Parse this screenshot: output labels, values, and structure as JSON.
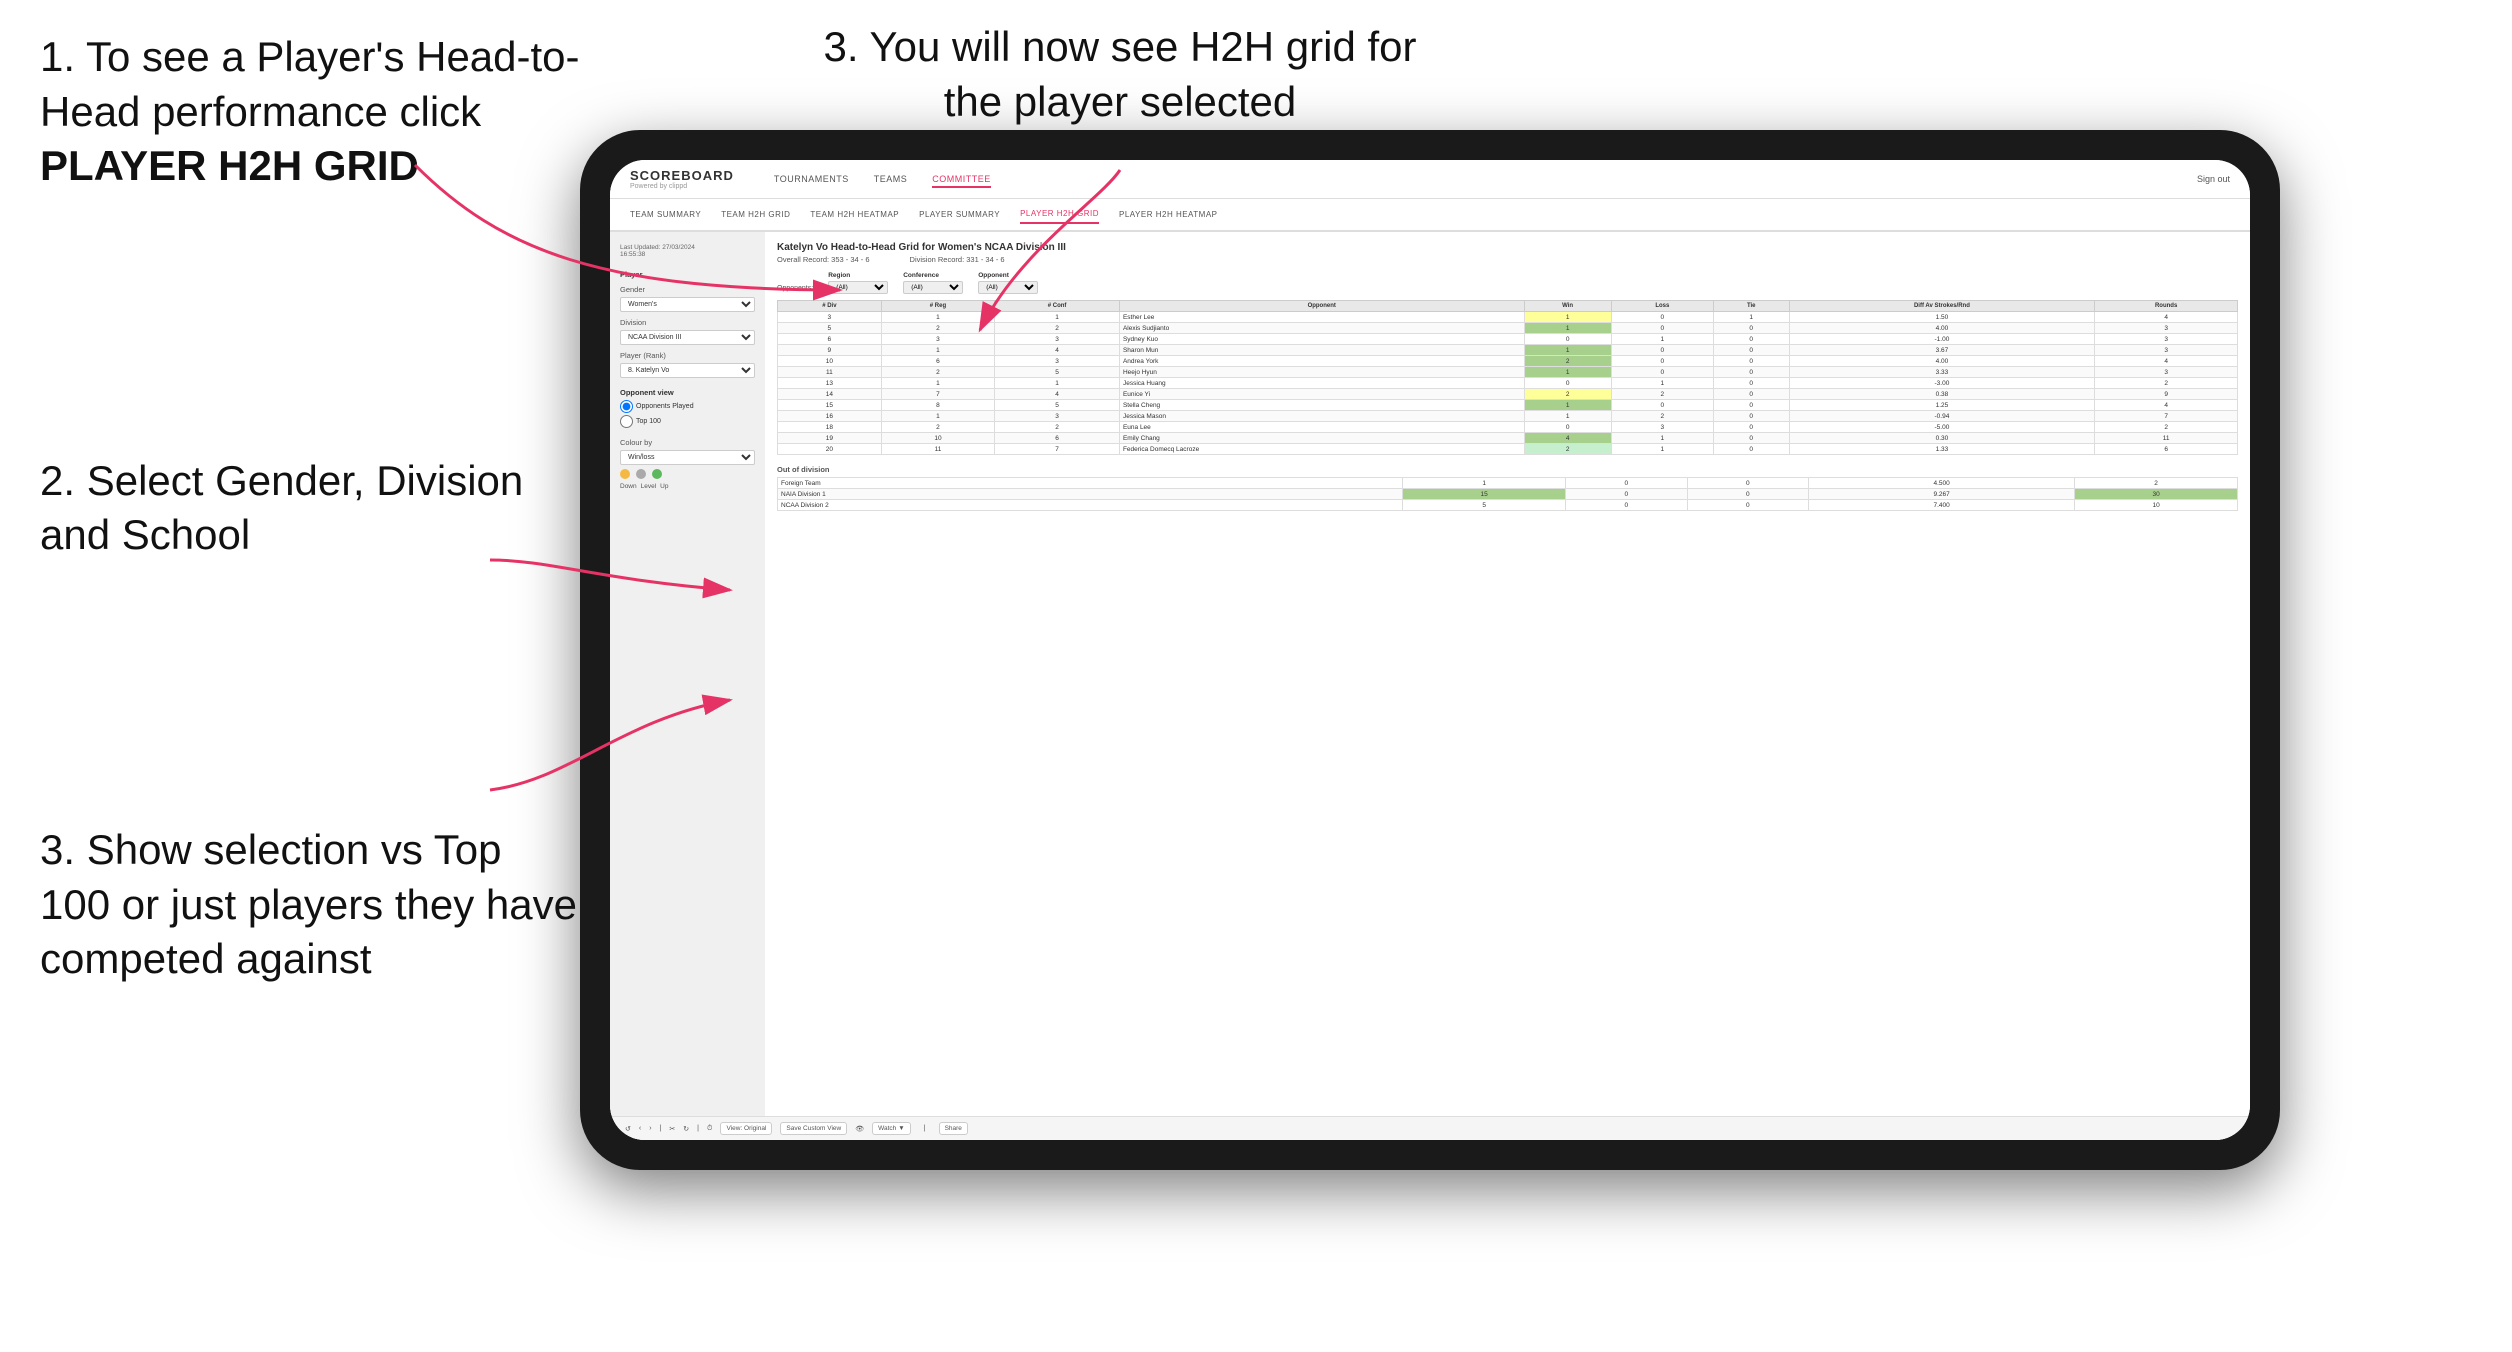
{
  "instructions": {
    "step1": {
      "text": "1. To see a Player's Head-to-Head performance click",
      "bold": "PLAYER H2H GRID"
    },
    "step2": {
      "text": "2. Select Gender, Division and School"
    },
    "step3_left": {
      "text": "3. Show selection vs Top 100 or just players they have competed against"
    },
    "step3_right": {
      "text": "3. You will now see H2H grid for the player selected"
    }
  },
  "nav": {
    "logo": "SCOREBOARD",
    "logo_sub": "Powered by clippd",
    "links": [
      "TOURNAMENTS",
      "TEAMS",
      "COMMITTEE"
    ],
    "sign_in": "Sign out",
    "active_link": "COMMITTEE"
  },
  "sub_nav": {
    "links": [
      "TEAM SUMMARY",
      "TEAM H2H GRID",
      "TEAM H2H HEATMAP",
      "PLAYER SUMMARY",
      "PLAYER H2H GRID",
      "PLAYER H2H HEATMAP"
    ],
    "active": "PLAYER H2H GRID"
  },
  "sidebar": {
    "timestamp": "Last Updated: 27/03/2024\n16:55:38",
    "player_label": "Player",
    "gender_label": "Gender",
    "gender_value": "Women's",
    "division_label": "Division",
    "division_value": "NCAA Division III",
    "player_rank_label": "Player (Rank)",
    "player_rank_value": "8. Katelyn Vo",
    "opponent_view_label": "Opponent view",
    "radio1": "Opponents Played",
    "radio2": "Top 100",
    "colour_label": "Colour by",
    "colour_value": "Win/loss",
    "legend": {
      "down_label": "Down",
      "level_label": "Level",
      "up_label": "Up",
      "down_color": "#f4b942",
      "level_color": "#999999",
      "up_color": "#5cb85c"
    }
  },
  "grid": {
    "title": "Katelyn Vo Head-to-Head Grid for Women's NCAA Division III",
    "overall_record": "Overall Record: 353 - 34 - 6",
    "division_record": "Division Record: 331 - 34 - 6",
    "filter_region_label": "Region",
    "filter_conference_label": "Conference",
    "filter_opponent_label": "Opponent",
    "opponents_label": "Opponents:",
    "filter_all": "(All)",
    "columns": [
      "# Div",
      "# Reg",
      "# Conf",
      "Opponent",
      "Win",
      "Loss",
      "Tie",
      "Diff Av Strokes/Rnd",
      "Rounds"
    ],
    "rows": [
      {
        "div": "3",
        "reg": "1",
        "conf": "1",
        "opponent": "Esther Lee",
        "win": "1",
        "loss": "0",
        "tie": "1",
        "diff": "1.50",
        "rounds": "4",
        "win_color": "yellow",
        "loss_color": "green"
      },
      {
        "div": "5",
        "reg": "2",
        "conf": "2",
        "opponent": "Alexis Sudjianto",
        "win": "1",
        "loss": "0",
        "tie": "0",
        "diff": "4.00",
        "rounds": "3",
        "win_color": "green"
      },
      {
        "div": "6",
        "reg": "3",
        "conf": "3",
        "opponent": "Sydney Kuo",
        "win": "0",
        "loss": "1",
        "tie": "0",
        "diff": "-1.00",
        "rounds": "3"
      },
      {
        "div": "9",
        "reg": "1",
        "conf": "4",
        "opponent": "Sharon Mun",
        "win": "1",
        "loss": "0",
        "tie": "0",
        "diff": "3.67",
        "rounds": "3",
        "win_color": "green"
      },
      {
        "div": "10",
        "reg": "6",
        "conf": "3",
        "opponent": "Andrea York",
        "win": "2",
        "loss": "0",
        "tie": "0",
        "diff": "4.00",
        "rounds": "4",
        "win_color": "green"
      },
      {
        "div": "11",
        "reg": "2",
        "conf": "5",
        "opponent": "Heejo Hyun",
        "win": "1",
        "loss": "0",
        "tie": "0",
        "diff": "3.33",
        "rounds": "3",
        "win_color": "green"
      },
      {
        "div": "13",
        "reg": "1",
        "conf": "1",
        "opponent": "Jessica Huang",
        "win": "0",
        "loss": "1",
        "tie": "0",
        "diff": "-3.00",
        "rounds": "2"
      },
      {
        "div": "14",
        "reg": "7",
        "conf": "4",
        "opponent": "Eunice Yi",
        "win": "2",
        "loss": "2",
        "tie": "0",
        "diff": "0.38",
        "rounds": "9",
        "win_color": "yellow"
      },
      {
        "div": "15",
        "reg": "8",
        "conf": "5",
        "opponent": "Stella Cheng",
        "win": "1",
        "loss": "0",
        "tie": "0",
        "diff": "1.25",
        "rounds": "4",
        "win_color": "green"
      },
      {
        "div": "16",
        "reg": "1",
        "conf": "3",
        "opponent": "Jessica Mason",
        "win": "1",
        "loss": "2",
        "tie": "0",
        "diff": "-0.94",
        "rounds": "7"
      },
      {
        "div": "18",
        "reg": "2",
        "conf": "2",
        "opponent": "Euna Lee",
        "win": "0",
        "loss": "3",
        "tie": "0",
        "diff": "-5.00",
        "rounds": "2"
      },
      {
        "div": "19",
        "reg": "10",
        "conf": "6",
        "opponent": "Emily Chang",
        "win": "4",
        "loss": "1",
        "tie": "0",
        "diff": "0.30",
        "rounds": "11",
        "win_color": "green"
      },
      {
        "div": "20",
        "reg": "11",
        "conf": "7",
        "opponent": "Federica Domecq Lacroze",
        "win": "2",
        "loss": "1",
        "tie": "0",
        "diff": "1.33",
        "rounds": "6",
        "win_color": "light-green"
      }
    ],
    "out_of_division_title": "Out of division",
    "out_of_division_rows": [
      {
        "opponent": "Foreign Team",
        "win": "1",
        "loss": "0",
        "tie": "0",
        "diff": "4.500",
        "rounds": "2"
      },
      {
        "opponent": "NAIA Division 1",
        "win": "15",
        "loss": "0",
        "tie": "0",
        "diff": "9.267",
        "rounds": "30"
      },
      {
        "opponent": "NCAA Division 2",
        "win": "5",
        "loss": "0",
        "tie": "0",
        "diff": "7.400",
        "rounds": "10"
      }
    ]
  },
  "toolbar": {
    "view_original": "View: Original",
    "save_custom_view": "Save Custom View",
    "watch": "Watch",
    "share": "Share"
  }
}
